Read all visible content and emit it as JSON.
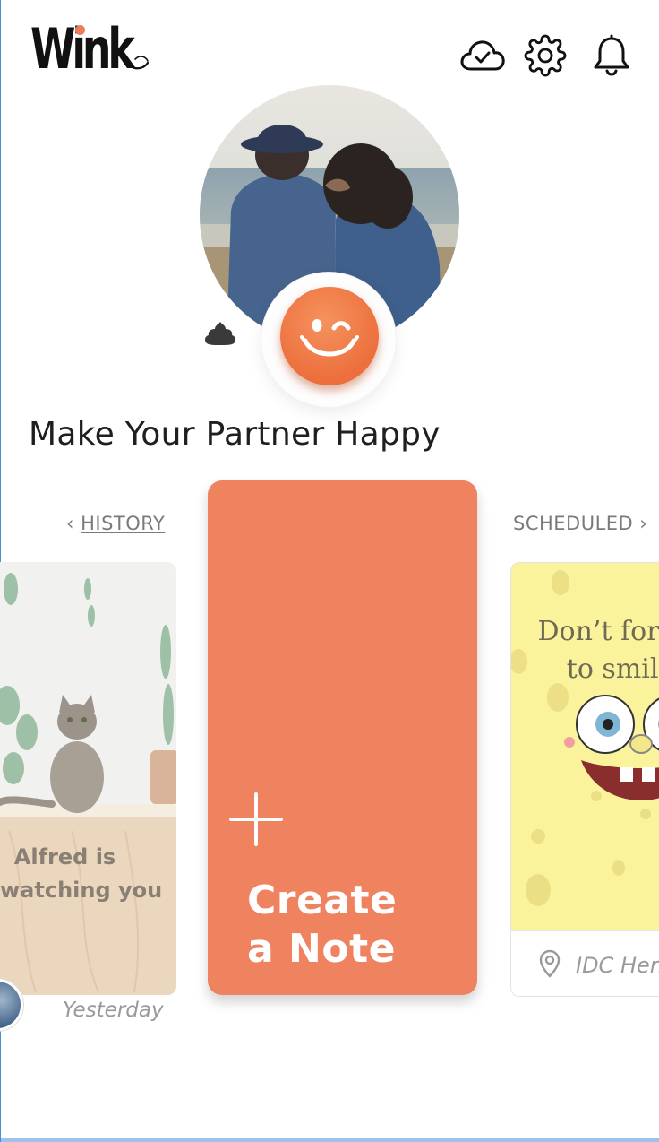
{
  "app": {
    "logo_text": "Wink"
  },
  "header": {
    "icons": [
      "cloud-check-icon",
      "gear-icon",
      "bell-icon"
    ]
  },
  "profile": {
    "headline": "Make Your Partner Happy"
  },
  "sections": {
    "history_label": "HISTORY",
    "scheduled_label": "SCHEDULED"
  },
  "history_card": {
    "caption": "Alfred is\nwatching you",
    "date": "Yesterday"
  },
  "create_card": {
    "label": "Create\na Note"
  },
  "scheduled_card": {
    "caption": "Don’t forget\nto smile",
    "location": "IDC Herzliya"
  },
  "colors": {
    "accent": "#ef8360",
    "wink_button": "#ec6f3d",
    "scheduled_bg": "#fbf29c",
    "frame": "#4a90d9"
  }
}
